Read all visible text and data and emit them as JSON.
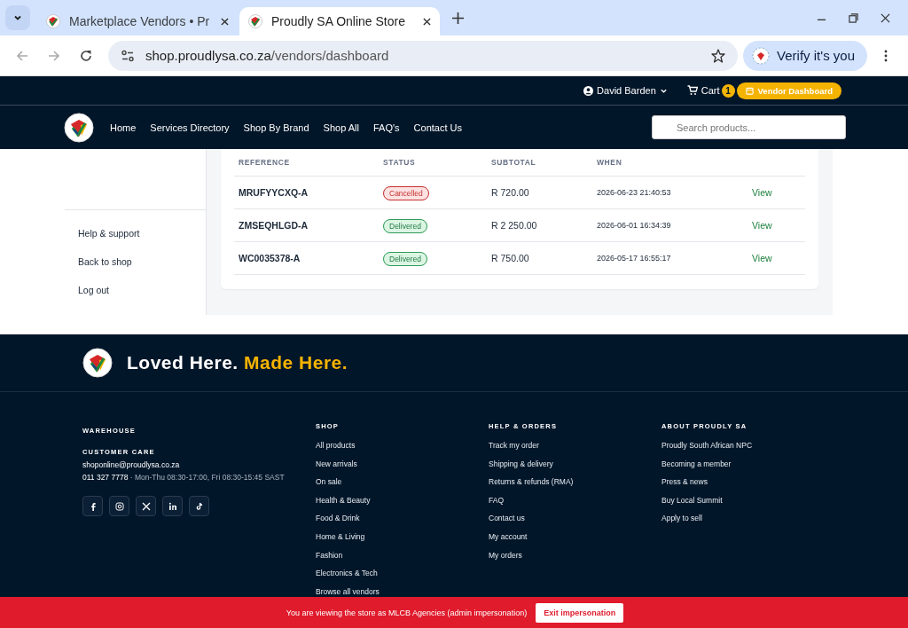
{
  "browser": {
    "tabs": [
      {
        "title": "Marketplace Vendors • Pr",
        "selected": false
      },
      {
        "title": "Proudly SA Online Store",
        "selected": true
      }
    ],
    "url_host": "shop.proudlysa.co.za",
    "url_path": "/vendors/dashboard",
    "verify_label": "Verify it's you"
  },
  "top_bar": {
    "user": "David Barden",
    "cart_label": "Cart",
    "cart_count": "1",
    "vendor_button": "Vendor Dashboard"
  },
  "nav": {
    "links": [
      "Home",
      "Services Directory",
      "Shop By Brand",
      "Shop All",
      "FAQ's",
      "Contact Us"
    ],
    "search": {
      "placeholder": "Search products..."
    }
  },
  "sidebar": {
    "items": [
      "Help & support",
      "Back to shop",
      "Log out"
    ]
  },
  "orders": {
    "columns": [
      "REFERENCE",
      "STATUS",
      "SUBTOTAL",
      "WHEN"
    ],
    "rows": [
      {
        "reference": "MRUFYYCXQ-A",
        "status": "Cancelled",
        "kind": "cancelled",
        "subtotal": "R 720.00",
        "when": "2026-06-23 21:40:53",
        "action": "View"
      },
      {
        "reference": "ZMSEQHLGD-A",
        "status": "Delivered",
        "kind": "delivered",
        "subtotal": "R 2 250.00",
        "when": "2026-06-01 16:34:39",
        "action": "View"
      },
      {
        "reference": "WC0035378-A",
        "status": "Delivered",
        "kind": "delivered",
        "subtotal": "R 750.00",
        "when": "2026-05-17 16:55:17",
        "action": "View"
      }
    ]
  },
  "footer": {
    "tagline_start": "Loved Here.",
    "tagline_accent": "Made Here.",
    "contact": {
      "warehouse_heading": "WAREHOUSE",
      "care_heading": "CUSTOMER CARE",
      "email": "shoponline@proudlysa.co.za",
      "phone": "011 327 7778",
      "hours": "· Mon-Thu 08:30-17:00, Fri 08:30-15:45 SAST"
    },
    "columns": [
      {
        "heading": "SHOP",
        "links": [
          "All products",
          "New arrivals",
          "On sale",
          "Health & Beauty",
          "Food & Drink",
          "Home & Living",
          "Fashion",
          "Electronics & Tech",
          "Browse all vendors"
        ]
      },
      {
        "heading": "HELP & ORDERS",
        "links": [
          "Track my order",
          "Shipping & delivery",
          "Returns & refunds (RMA)",
          "FAQ",
          "Contact us",
          "My account",
          "My orders"
        ]
      },
      {
        "heading": "ABOUT PROUDLY SA",
        "links": [
          "Proudly South African NPC",
          "Becoming a member",
          "Press & news",
          "Buy Local Summit",
          "Apply to sell"
        ]
      }
    ]
  },
  "impersonation_bar": {
    "message": "You are viewing the store as MLCB Agencies (admin impersonation)",
    "button": "Exit impersonation"
  }
}
